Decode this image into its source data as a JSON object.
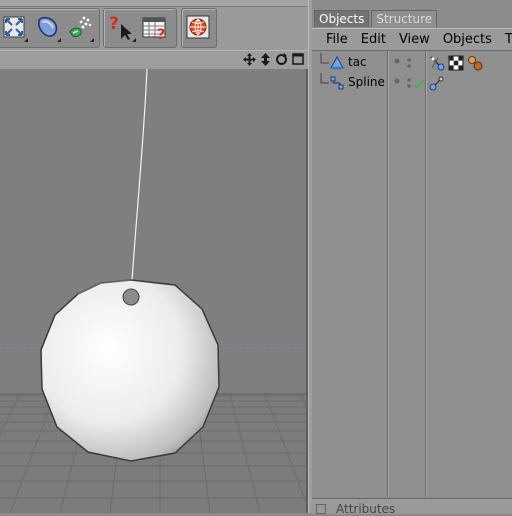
{
  "toolbar": {
    "buttons": [
      {
        "name": "fit-all-icon"
      },
      {
        "name": "deformer-shield-icon"
      },
      {
        "name": "scatter-paint-icon"
      },
      {
        "name": "help-cursor-icon"
      },
      {
        "name": "help-table-icon"
      },
      {
        "name": "render-globe-icon"
      }
    ]
  },
  "viewport": {
    "nav_icons": [
      "move-view-icon",
      "zoom-view-icon",
      "rotate-view-icon",
      "maximize-view-icon"
    ]
  },
  "object_manager": {
    "tabs": [
      {
        "label": "Objects",
        "active": true
      },
      {
        "label": "Structure",
        "active": false
      }
    ],
    "menu": [
      "File",
      "Edit",
      "View",
      "Objects",
      "T"
    ],
    "objects": [
      {
        "name": "tac",
        "icon": "cone-object-icon",
        "tags": [
          "deformer-tag-icon",
          "checker-texture-tag-icon",
          "material-spheres-tag-icon"
        ]
      },
      {
        "name": "Spline",
        "icon": "spline-object-icon",
        "tags": [
          "spline-tag-icon"
        ]
      }
    ],
    "attributes_label": "Attributes"
  },
  "colors": {
    "panel_bg": "#8c8c8c",
    "viewport_bg": "#7f7f7f",
    "active_tab": "#727272",
    "check_green": "#3fb64a"
  }
}
